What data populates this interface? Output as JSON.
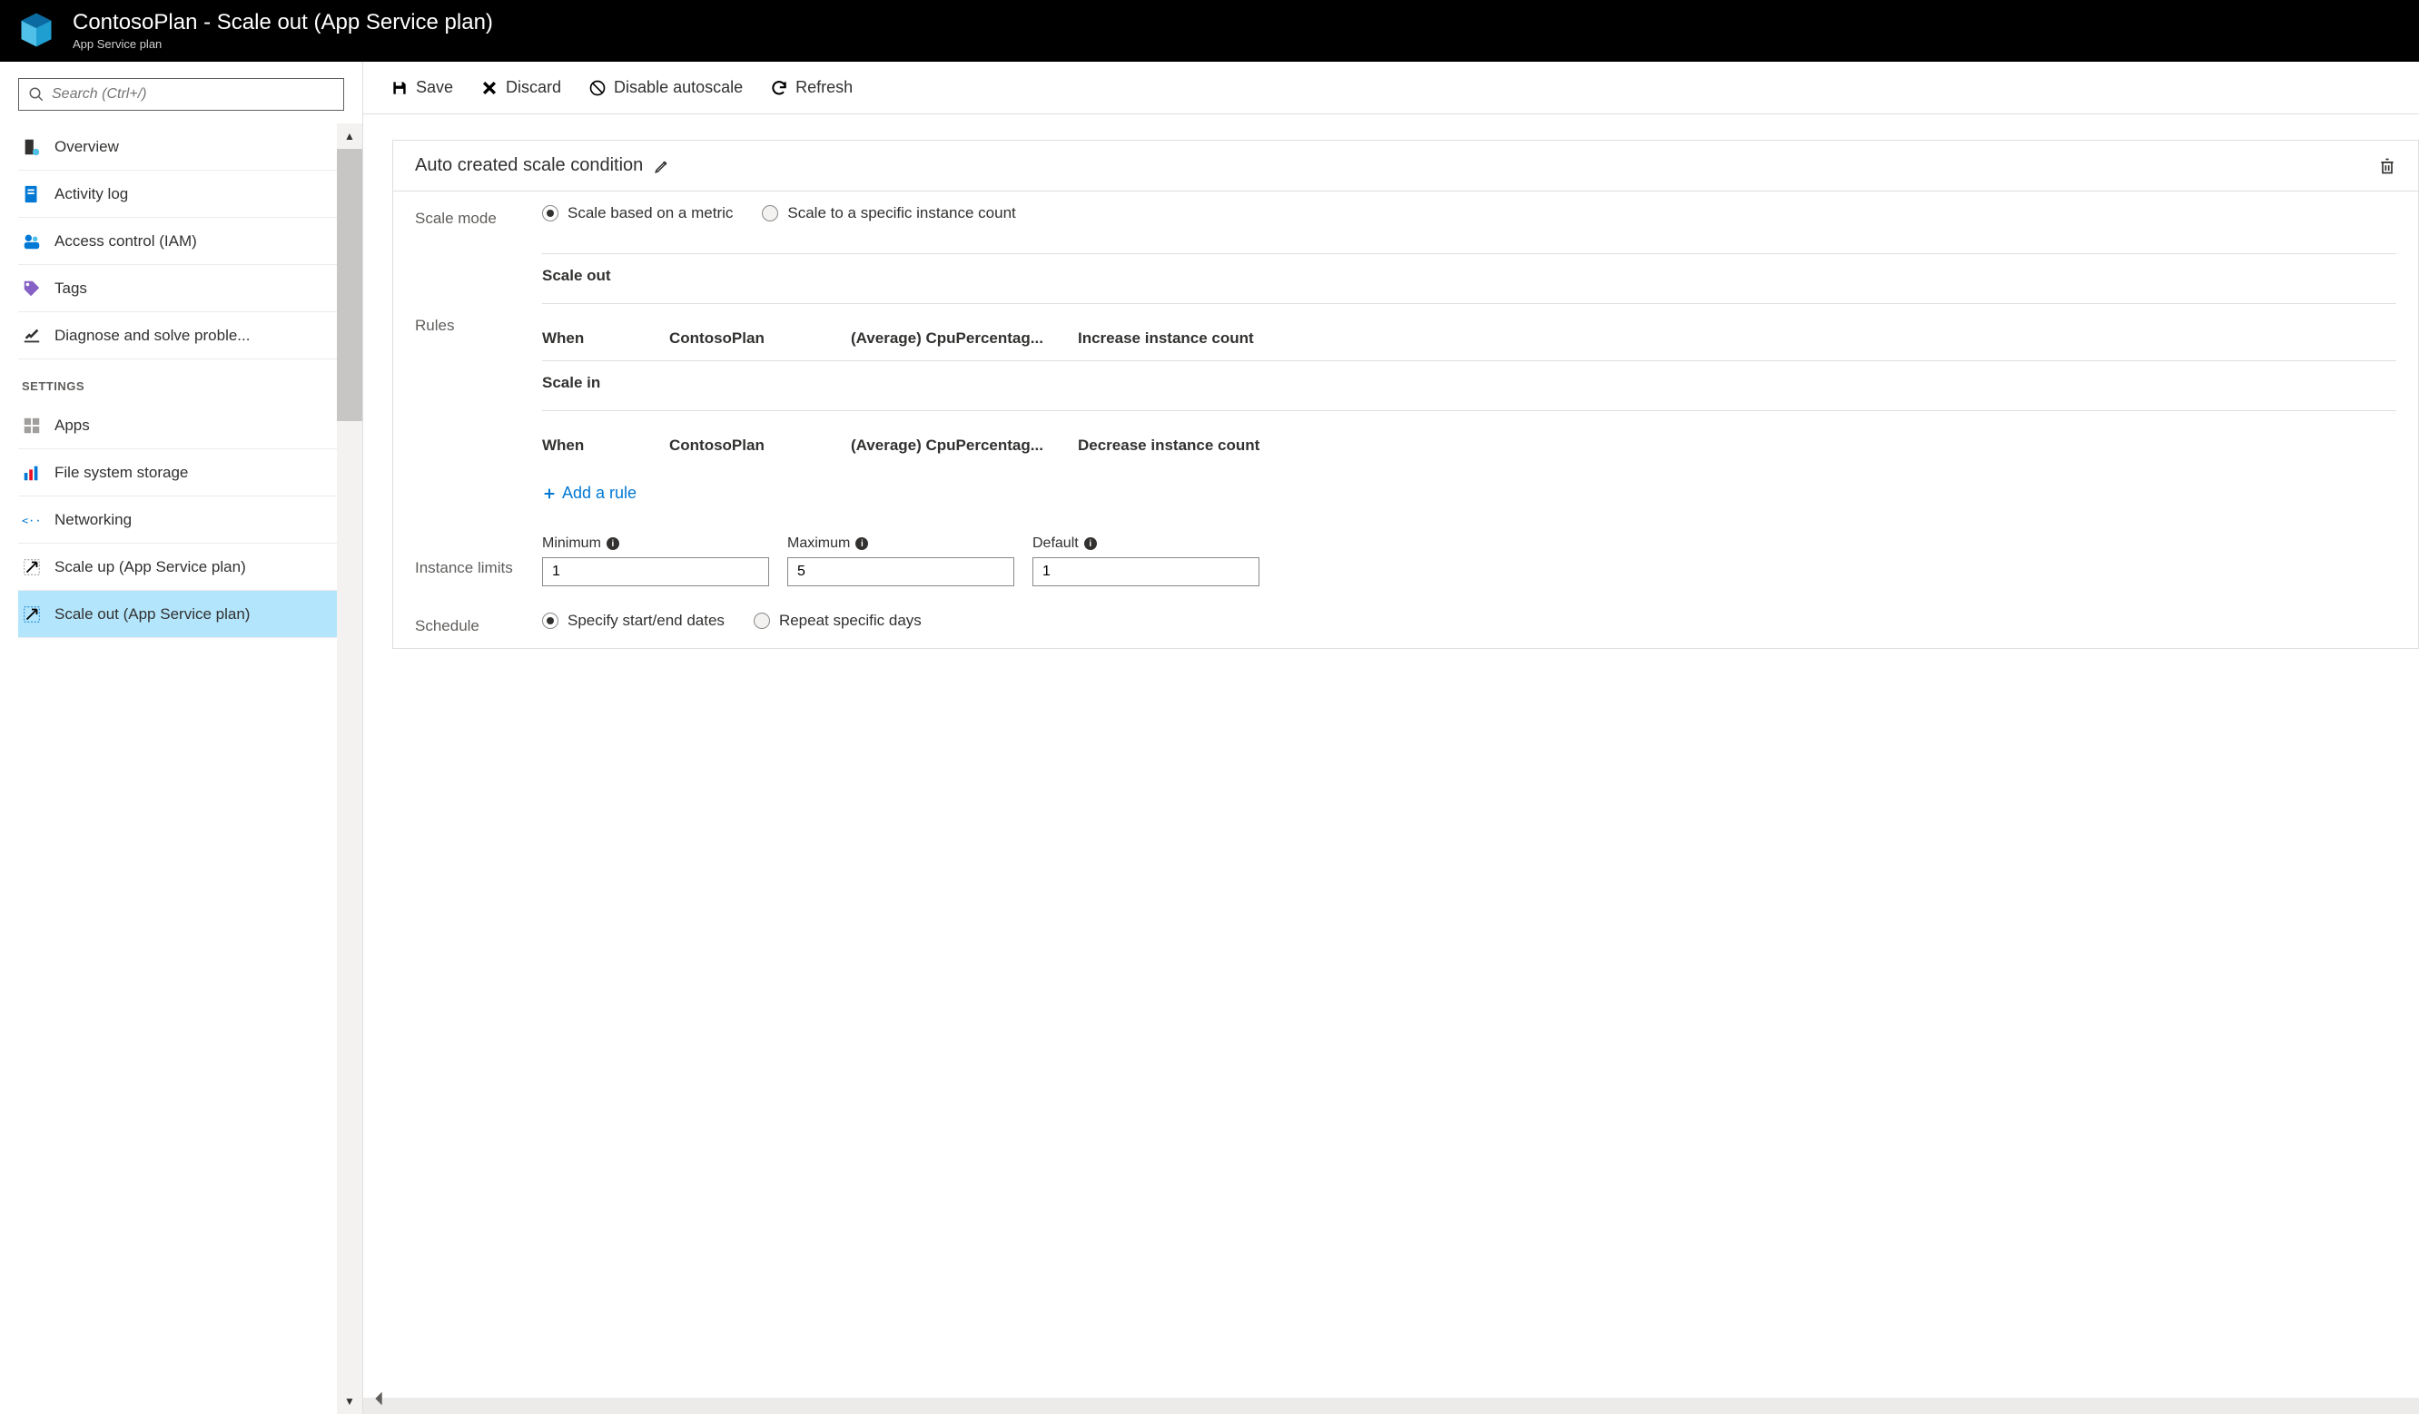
{
  "header": {
    "title": "ContosoPlan - Scale out (App Service plan)",
    "subtitle": "App Service plan"
  },
  "sidebar": {
    "search_placeholder": "Search (Ctrl+/)",
    "items_top": [
      {
        "label": "Overview",
        "icon": "server"
      },
      {
        "label": "Activity log",
        "icon": "log"
      },
      {
        "label": "Access control (IAM)",
        "icon": "people"
      },
      {
        "label": "Tags",
        "icon": "tag"
      },
      {
        "label": "Diagnose and solve proble...",
        "icon": "tools"
      }
    ],
    "section_label": "SETTINGS",
    "items_settings": [
      {
        "label": "Apps",
        "icon": "apps"
      },
      {
        "label": "File system storage",
        "icon": "chart"
      },
      {
        "label": "Networking",
        "icon": "net"
      },
      {
        "label": "Scale up (App Service plan)",
        "icon": "scaleup"
      },
      {
        "label": "Scale out (App Service plan)",
        "icon": "scaleout",
        "selected": true
      }
    ]
  },
  "toolbar": {
    "save": "Save",
    "discard": "Discard",
    "disable": "Disable autoscale",
    "refresh": "Refresh"
  },
  "card": {
    "title": "Auto created scale condition",
    "labels": {
      "scale_mode": "Scale mode",
      "rules": "Rules",
      "instance_limits": "Instance limits",
      "schedule": "Schedule"
    },
    "mode_opts": {
      "metric": "Scale based on a metric",
      "count": "Scale to a specific instance count"
    },
    "rules": {
      "scale_out_hdr": "Scale out",
      "scale_in_hdr": "Scale in",
      "out": {
        "when": "When",
        "plan": "ContosoPlan",
        "metric": "(Average) CpuPercentag...",
        "action": "Increase instance count"
      },
      "in": {
        "when": "When",
        "plan": "ContosoPlan",
        "metric": "(Average) CpuPercentag...",
        "action": "Decrease instance count"
      },
      "add_rule": "Add a rule"
    },
    "limits": {
      "min_label": "Minimum",
      "min_value": "1",
      "max_label": "Maximum",
      "max_value": "5",
      "def_label": "Default",
      "def_value": "1"
    },
    "schedule_opts": {
      "dates": "Specify start/end dates",
      "days": "Repeat specific days"
    }
  }
}
